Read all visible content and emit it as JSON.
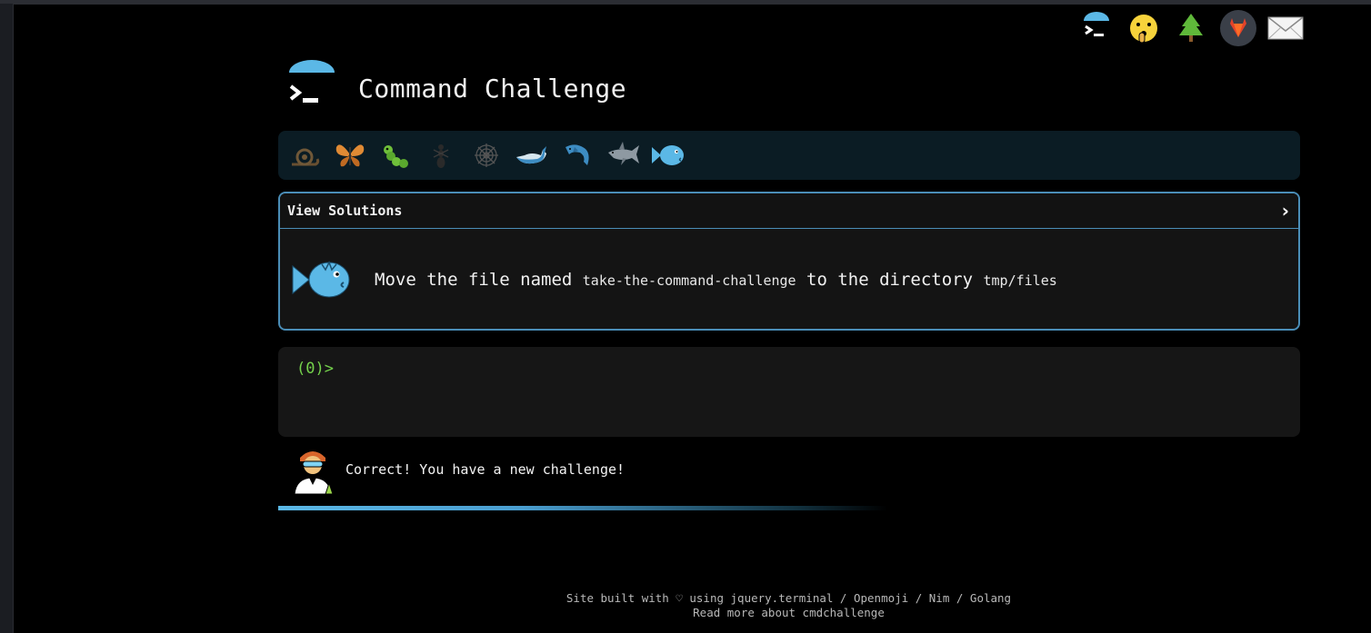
{
  "header": {
    "title": "Command Challenge"
  },
  "top_icons": [
    {
      "name": "terminal-umbrella-icon"
    },
    {
      "name": "shushing-face-icon"
    },
    {
      "name": "tree-icon"
    },
    {
      "name": "gitlab-icon"
    },
    {
      "name": "mail-icon"
    }
  ],
  "levels": [
    {
      "name": "snail-icon"
    },
    {
      "name": "butterfly-icon"
    },
    {
      "name": "caterpillar-icon"
    },
    {
      "name": "ant-icon"
    },
    {
      "name": "spider-web-icon"
    },
    {
      "name": "whale-icon"
    },
    {
      "name": "dolphin-icon"
    },
    {
      "name": "shark-icon"
    },
    {
      "name": "blowfish-icon"
    }
  ],
  "challenge": {
    "solutions_label": "View Solutions",
    "text_prefix": "Move the file named ",
    "file_name": "take-the-command-challenge",
    "text_middle": " to the directory ",
    "dir_name": "tmp/files"
  },
  "terminal": {
    "prompt": "(0)>"
  },
  "status": {
    "message": "Correct! You have a new challenge!"
  },
  "progress": {
    "fraction": 0.6
  },
  "footer": {
    "line1": "Site built with ♡ using jquery.terminal / Openmoji / Nim / Golang",
    "line2": "Read more about cmdchallenge"
  },
  "colors": {
    "accent": "#4a8db7",
    "prompt": "#74d14b",
    "background": "#000000"
  }
}
